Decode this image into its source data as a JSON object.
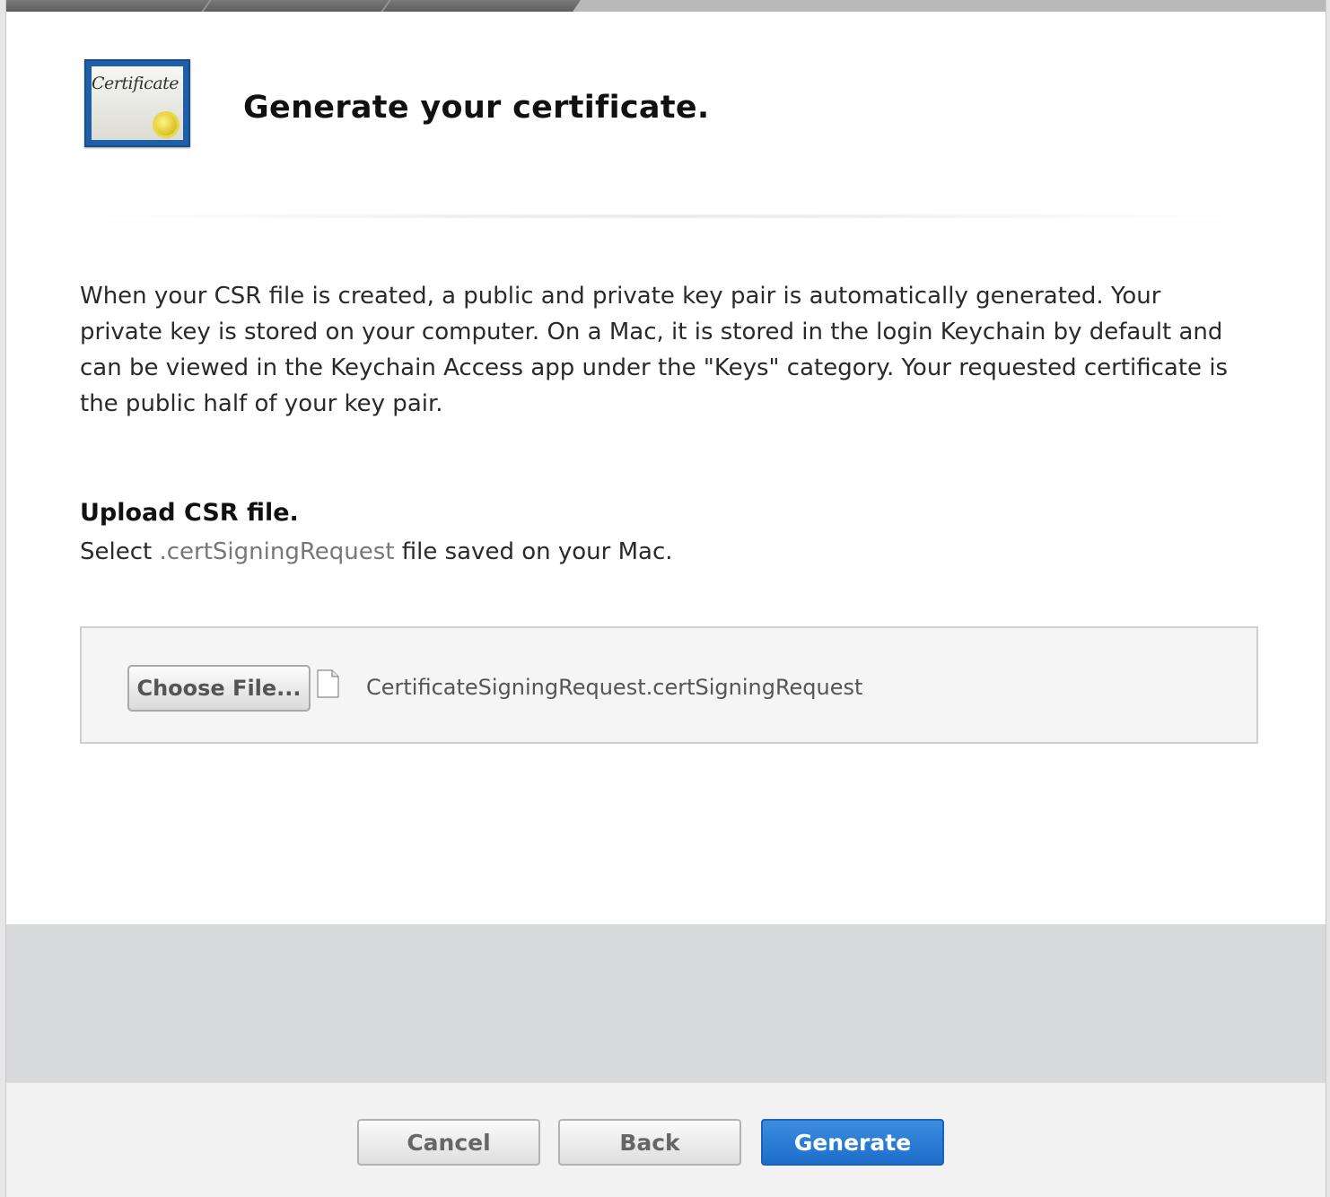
{
  "header": {
    "title": "Generate your certificate.",
    "icon_text": "Certificate",
    "icon_name": "certificate-icon"
  },
  "description": "When your CSR file is created, a public and private key pair is automatically generated. Your private key is stored on your computer. On a Mac, it is stored in the login Keychain by default and can be viewed in the Keychain Access app under the \"Keys\" category. Your requested certificate is the public half of your key pair.",
  "upload": {
    "heading": "Upload CSR file.",
    "sub_before": "Select ",
    "sub_ext": ".certSigningRequest",
    "sub_after": " file saved on your Mac.",
    "choose_label": "Choose File...",
    "file_name": "CertificateSigningRequest.certSigningRequest",
    "file_icon_name": "document-icon"
  },
  "footer": {
    "cancel_label": "Cancel",
    "back_label": "Back",
    "generate_label": "Generate"
  },
  "colors": {
    "primary": "#1d6ec9",
    "certificate_blue": "#1e5fa8",
    "seal_gold": "#d8c020"
  }
}
